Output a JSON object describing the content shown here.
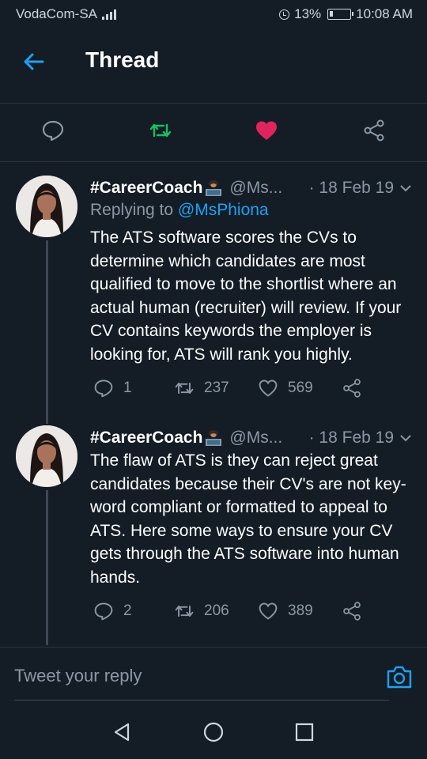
{
  "status_bar": {
    "carrier": "VodaCom-SA",
    "alarm_icon": "alarm-clock-icon",
    "battery_percent": "13%",
    "time": "10:08 AM"
  },
  "header": {
    "title": "Thread",
    "back_icon": "arrow-left-icon"
  },
  "action_bar": {
    "icons": [
      "reply-icon",
      "retweet-icon",
      "like-icon",
      "share-icon"
    ],
    "retweet_color": "#17bf63",
    "like_color": "#e0245e"
  },
  "tweets": [
    {
      "name": "#CareerCoach",
      "handle": "@Ms...",
      "date": "· 18 Feb 19",
      "replying_prefix": "Replying to ",
      "replying_to": "@MsPhiona",
      "text": "The ATS software scores the CVs to determine which candidates are most qualified to move to the shortlist where an actual human (recruiter) will review. If your CV contains keywords the employer is looking for, ATS will rank you highly.",
      "replies": "1",
      "retweets": "237",
      "likes": "569"
    },
    {
      "name": "#CareerCoach",
      "handle": "@Ms...",
      "date": "· 18 Feb 19",
      "text": "The flaw of ATS is they can reject great candidates because their CV's are not key-word compliant or formatted to appeal to ATS. Here some ways to ensure your CV gets through the ATS software into human hands.",
      "replies": "2",
      "retweets": "206",
      "likes": "389"
    }
  ],
  "reply": {
    "placeholder": "Tweet your reply",
    "camera_icon": "camera-icon"
  },
  "nav": {
    "icons": [
      "back-triangle-icon",
      "home-circle-icon",
      "recents-square-icon"
    ]
  },
  "colors": {
    "background": "#141d26",
    "accent": "#1da1f2",
    "muted": "#8b98a5"
  }
}
